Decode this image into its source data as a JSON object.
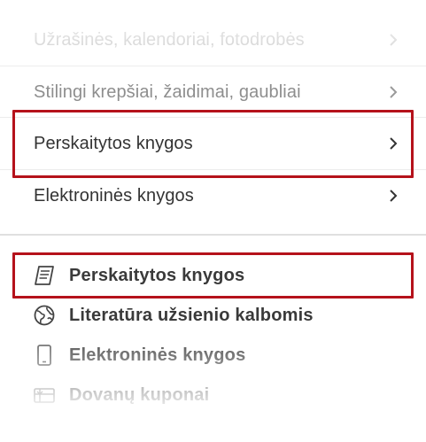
{
  "menu": {
    "items": [
      {
        "label": "Užrašinės, kalendoriai, fotodrobės"
      },
      {
        "label": "Stilingi krepšiai, žaidimai, gaubliai"
      },
      {
        "label": "Perskaitytos knygos"
      },
      {
        "label": "Elektroninės knygos"
      }
    ]
  },
  "submenu": {
    "items": [
      {
        "label": "Perskaitytos knygos",
        "icon": "book-icon"
      },
      {
        "label": "Literatūra užsienio kalbomis",
        "icon": "globe-icon"
      },
      {
        "label": "Elektroninės knygos",
        "icon": "tablet-icon"
      },
      {
        "label": "Dovanų kuponai",
        "icon": "gift-card-icon"
      }
    ]
  },
  "colors": {
    "highlight": "#b5121b",
    "text": "#333333",
    "muted": "#9a9a9a"
  }
}
